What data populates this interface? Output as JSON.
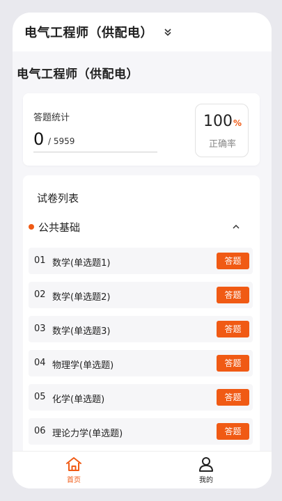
{
  "header": {
    "title": "电气工程师（供配电）",
    "toggle_icon": "double-chevron-down-icon"
  },
  "page": {
    "title": "电气工程师（供配电）"
  },
  "stats": {
    "label": "答题统计",
    "answered": "0",
    "total": "/ 5959",
    "rate_value": "100",
    "rate_unit": "%",
    "rate_label": "正确率"
  },
  "papers": {
    "title": "试卷列表",
    "section": {
      "name": "公共基础",
      "expanded": true
    },
    "items": [
      {
        "num": "01",
        "name": "数学(单选题1)",
        "action": "答题"
      },
      {
        "num": "02",
        "name": "数学(单选题2)",
        "action": "答题"
      },
      {
        "num": "03",
        "name": "数学(单选题3)",
        "action": "答题"
      },
      {
        "num": "04",
        "name": "物理学(单选题)",
        "action": "答题"
      },
      {
        "num": "05",
        "name": "化学(单选题)",
        "action": "答题"
      },
      {
        "num": "06",
        "name": "理论力学(单选题)",
        "action": "答题"
      }
    ]
  },
  "tabbar": {
    "home": {
      "label": "首页",
      "icon": "home-icon",
      "active": true
    },
    "mine": {
      "label": "我的",
      "icon": "user-icon",
      "active": false
    }
  },
  "colors": {
    "accent": "#f05a14",
    "background": "#f6f6f9",
    "card": "#ffffff"
  }
}
